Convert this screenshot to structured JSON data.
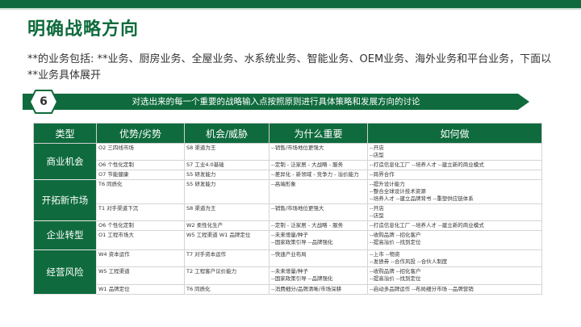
{
  "title": "明确战略方向",
  "intro": "**的业务包括: **业务、厨房业务、全屋业务、水系统业务、智能业务、OEM业务、海外业务和平台业务，下面以**业务具体展开",
  "step_number": "6",
  "banner_text": "对选出来的每一个重要的战略输入点按照原则进行具体策略和发展方向的讨论",
  "colors": {
    "brand_green": "#0f6b3d",
    "accent_line": "#c9ddd0"
  },
  "table": {
    "headers": [
      "类型",
      "优势/劣势",
      "机会/威胁",
      "为什么重要",
      "如何做"
    ],
    "groups": [
      {
        "category": "商业机会",
        "rows": [
          {
            "adv": [
              "O2 三四线市场"
            ],
            "opp": [
              "S8 渠道为王"
            ],
            "why": [
              "--销售/市场地位更强大"
            ],
            "how": [
              "--开店",
              "--店型"
            ]
          },
          {
            "adv": [
              "O6 个性化定制"
            ],
            "opp": [
              "S7 工业4.0基础"
            ],
            "why": [
              "--定制 - 泛家居 - 大战略 - 服务"
            ],
            "how": [
              "--打造信息化工厂   --培养人才     --建立新的商业模式"
            ]
          },
          {
            "adv": [
              "O7 节能健康"
            ],
            "opp": [
              "S5 研发能力"
            ],
            "why": [
              "--差异化 - 新领域 - 竞争力 - 溢价能力"
            ],
            "how": [
              "--跨界合作"
            ]
          }
        ]
      },
      {
        "category": "开拓新市场",
        "rows": [
          {
            "adv": [
              "T6 同质化"
            ],
            "opp": [
              "S5 研发能力"
            ],
            "why": [
              "--高端形象"
            ],
            "how": [
              "--提升设计能力",
              "--整合全球设计技术资源",
              "--培养人才       --建立品牌背书   --重塑供应链体系"
            ]
          },
          {
            "adv": [
              "T1 对手渠道下沉"
            ],
            "opp": [
              "S8 渠道为王"
            ],
            "why": [
              "--销售/市场地位更强大"
            ],
            "how": [
              "--开店",
              "--店型"
            ]
          }
        ]
      },
      {
        "category": "企业转型",
        "rows": [
          {
            "adv": [
              "O6 个性化定制"
            ],
            "opp": [
              "W2 柔性化生产"
            ],
            "why": [
              "--定制 - 泛家居 - 大战略 - 服务"
            ],
            "how": [
              "--打造信息化工厂   --培养人才     --建立新的商业模式"
            ]
          },
          {
            "adv": [
              "O1 工程市场大"
            ],
            "opp": [
              "W5 工程渠道 W1 品牌定位"
            ],
            "why": [
              "--未来增量/种子",
              "--国家政策引导     --品牌强化"
            ],
            "how": [
              "--收购品牌       --招化客户",
              "--提高溢价       --找到定位"
            ]
          }
        ]
      },
      {
        "category": "经营风险",
        "rows": [
          {
            "adv": [
              "W4 资本运作"
            ],
            "opp": [
              "T7 对手资本运作"
            ],
            "why": [
              "--快速产业布局"
            ],
            "how": [
              "--上市    --物资",
              "--发债券         --合作风投 --合伙人制度"
            ]
          },
          {
            "adv": [
              "W5 工程渠道"
            ],
            "opp": [
              "T2 工程客户议价能力"
            ],
            "why": [
              "--未来增量/种子",
              "--国家政策引导     --品牌强化"
            ],
            "how": [
              "--收购品牌       --招化客户",
              "--提高溢价       --找到定位"
            ]
          },
          {
            "adv": [
              "W1 品牌定位"
            ],
            "opp": [
              "T6 同质化"
            ],
            "why": [
              "--消费细分/品牌清晰/市场深耕"
            ],
            "how": [
              "--启动多品牌运作 --布局细分市场 --品牌营销"
            ]
          }
        ]
      }
    ]
  }
}
